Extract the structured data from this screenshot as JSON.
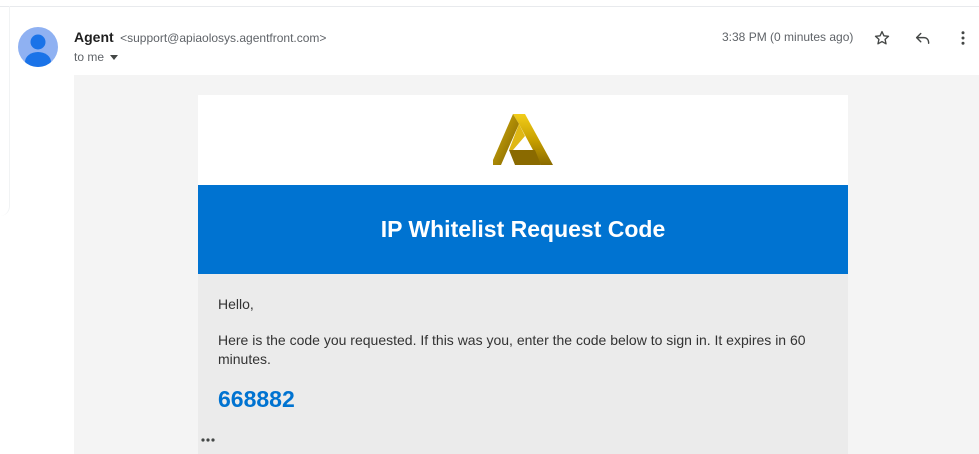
{
  "sender": {
    "name": "Agent",
    "email": "<support@apiaolosys.agentfront.com>",
    "recipient_label": "to me"
  },
  "header": {
    "timestamp": "3:38 PM (0 minutes ago)"
  },
  "icons": {
    "avatar": "person-avatar-icon",
    "star": "star-icon",
    "reply": "reply-icon",
    "more": "more-vert-icon",
    "expand": "more-horiz-icon",
    "logo": "agent-logo-icon"
  },
  "email": {
    "title": "IP Whitelist Request Code",
    "greeting": "Hello,",
    "body": "Here is the code you requested. If this was you, enter the code below to sign in. It expires in 60 minutes.",
    "code": "668882"
  },
  "colors": {
    "banner": "#0073d1",
    "code": "#0073d1",
    "logo_gold": "#c9a100",
    "avatar_bg": "#8fb1f2"
  }
}
